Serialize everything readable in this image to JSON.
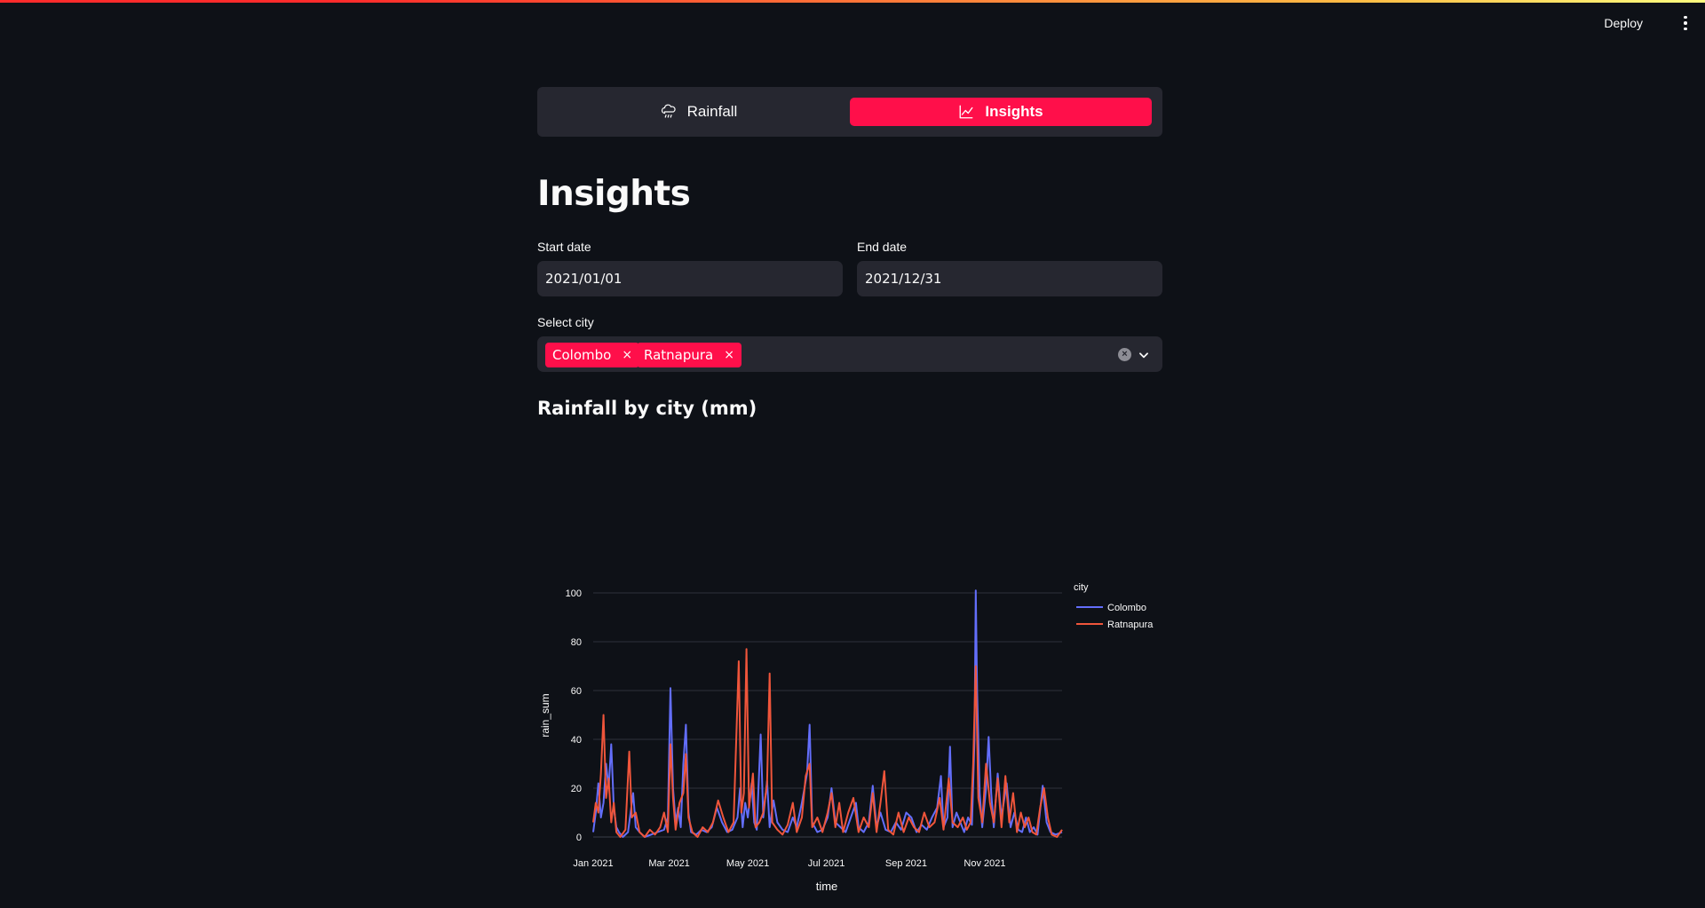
{
  "header": {
    "deploy_label": "Deploy",
    "menu_icon": "kebab-menu-icon"
  },
  "nav": {
    "items": [
      {
        "label": "Rainfall",
        "icon": "rain-cloud-icon",
        "active": false
      },
      {
        "label": "Insights",
        "icon": "line-chart-icon",
        "active": true
      }
    ],
    "accent": "#ff0f4a"
  },
  "page": {
    "title": "Insights",
    "subheader": "Rainfall by city (mm)"
  },
  "filters": {
    "start_label": "Start date",
    "start_value": "2021/01/01",
    "end_label": "End date",
    "end_value": "2021/12/31",
    "city_label": "Select city",
    "cities": [
      "Colombo",
      "Ratnapura"
    ],
    "tag_remove": "×"
  },
  "chart_data": {
    "type": "line",
    "xlabel": "time",
    "ylabel": "rain_sum",
    "legend_title": "city",
    "legend_position": "top-right",
    "grid": true,
    "ylim": [
      0,
      100
    ],
    "yticks": [
      0,
      20,
      40,
      60,
      80,
      100
    ],
    "xlim": [
      "2021-01-01",
      "2021-12-31"
    ],
    "xticks": [
      {
        "date": "2021-01-01",
        "label": "Jan 2021"
      },
      {
        "date": "2021-03-01",
        "label": "Mar 2021"
      },
      {
        "date": "2021-05-01",
        "label": "May 2021"
      },
      {
        "date": "2021-07-01",
        "label": "Jul 2021"
      },
      {
        "date": "2021-09-01",
        "label": "Sep 2021"
      },
      {
        "date": "2021-11-01",
        "label": "Nov 2021"
      }
    ],
    "series": [
      {
        "name": "Colombo",
        "color": "#636efa",
        "points": [
          [
            "2021-01-01",
            2
          ],
          [
            "2021-01-03",
            10
          ],
          [
            "2021-01-05",
            22
          ],
          [
            "2021-01-07",
            8
          ],
          [
            "2021-01-09",
            14
          ],
          [
            "2021-01-11",
            30
          ],
          [
            "2021-01-13",
            20
          ],
          [
            "2021-01-15",
            38
          ],
          [
            "2021-01-17",
            12
          ],
          [
            "2021-01-19",
            4
          ],
          [
            "2021-01-21",
            2
          ],
          [
            "2021-01-24",
            0
          ],
          [
            "2021-01-28",
            2
          ],
          [
            "2021-02-01",
            18
          ],
          [
            "2021-02-03",
            4
          ],
          [
            "2021-02-06",
            2
          ],
          [
            "2021-02-10",
            0
          ],
          [
            "2021-02-15",
            1
          ],
          [
            "2021-02-20",
            2
          ],
          [
            "2021-02-25",
            3
          ],
          [
            "2021-02-28",
            8
          ],
          [
            "2021-03-02",
            61
          ],
          [
            "2021-03-04",
            20
          ],
          [
            "2021-03-06",
            6
          ],
          [
            "2021-03-08",
            12
          ],
          [
            "2021-03-10",
            4
          ],
          [
            "2021-03-12",
            30
          ],
          [
            "2021-03-14",
            46
          ],
          [
            "2021-03-16",
            10
          ],
          [
            "2021-03-18",
            2
          ],
          [
            "2021-03-22",
            1
          ],
          [
            "2021-03-26",
            3
          ],
          [
            "2021-03-30",
            2
          ],
          [
            "2021-04-03",
            4
          ],
          [
            "2021-04-07",
            12
          ],
          [
            "2021-04-11",
            6
          ],
          [
            "2021-04-15",
            2
          ],
          [
            "2021-04-19",
            3
          ],
          [
            "2021-04-23",
            8
          ],
          [
            "2021-04-25",
            20
          ],
          [
            "2021-04-27",
            4
          ],
          [
            "2021-04-29",
            14
          ],
          [
            "2021-05-01",
            8
          ],
          [
            "2021-05-04",
            22
          ],
          [
            "2021-05-06",
            6
          ],
          [
            "2021-05-08",
            3
          ],
          [
            "2021-05-11",
            42
          ],
          [
            "2021-05-13",
            8
          ],
          [
            "2021-05-16",
            23
          ],
          [
            "2021-05-18",
            4
          ],
          [
            "2021-05-21",
            15
          ],
          [
            "2021-05-24",
            6
          ],
          [
            "2021-05-28",
            3
          ],
          [
            "2021-06-01",
            2
          ],
          [
            "2021-06-05",
            8
          ],
          [
            "2021-06-08",
            4
          ],
          [
            "2021-06-12",
            14
          ],
          [
            "2021-06-16",
            26
          ],
          [
            "2021-06-18",
            46
          ],
          [
            "2021-06-20",
            6
          ],
          [
            "2021-06-24",
            2
          ],
          [
            "2021-06-28",
            3
          ],
          [
            "2021-07-02",
            8
          ],
          [
            "2021-07-05",
            20
          ],
          [
            "2021-07-08",
            6
          ],
          [
            "2021-07-12",
            4
          ],
          [
            "2021-07-16",
            2
          ],
          [
            "2021-07-20",
            8
          ],
          [
            "2021-07-24",
            14
          ],
          [
            "2021-07-26",
            4
          ],
          [
            "2021-07-30",
            2
          ],
          [
            "2021-08-03",
            6
          ],
          [
            "2021-08-06",
            21
          ],
          [
            "2021-08-09",
            4
          ],
          [
            "2021-08-12",
            10
          ],
          [
            "2021-08-16",
            3
          ],
          [
            "2021-08-20",
            2
          ],
          [
            "2021-08-24",
            6
          ],
          [
            "2021-08-28",
            3
          ],
          [
            "2021-09-01",
            10
          ],
          [
            "2021-09-05",
            8
          ],
          [
            "2021-09-09",
            2
          ],
          [
            "2021-09-13",
            5
          ],
          [
            "2021-09-17",
            3
          ],
          [
            "2021-09-21",
            8
          ],
          [
            "2021-09-25",
            12
          ],
          [
            "2021-09-28",
            25
          ],
          [
            "2021-09-30",
            4
          ],
          [
            "2021-10-03",
            8
          ],
          [
            "2021-10-05",
            37
          ],
          [
            "2021-10-07",
            4
          ],
          [
            "2021-10-10",
            10
          ],
          [
            "2021-10-13",
            6
          ],
          [
            "2021-10-16",
            2
          ],
          [
            "2021-10-19",
            8
          ],
          [
            "2021-10-22",
            5
          ],
          [
            "2021-10-24",
            40
          ],
          [
            "2021-10-25",
            101
          ],
          [
            "2021-10-26",
            60
          ],
          [
            "2021-10-28",
            18
          ],
          [
            "2021-10-30",
            4
          ],
          [
            "2021-11-02",
            20
          ],
          [
            "2021-11-04",
            41
          ],
          [
            "2021-11-06",
            18
          ],
          [
            "2021-11-08",
            4
          ],
          [
            "2021-11-11",
            26
          ],
          [
            "2021-11-14",
            8
          ],
          [
            "2021-11-18",
            22
          ],
          [
            "2021-11-21",
            4
          ],
          [
            "2021-11-24",
            10
          ],
          [
            "2021-11-27",
            3
          ],
          [
            "2021-11-30",
            2
          ],
          [
            "2021-12-03",
            8
          ],
          [
            "2021-12-06",
            2
          ],
          [
            "2021-12-09",
            4
          ],
          [
            "2021-12-12",
            1
          ],
          [
            "2021-12-16",
            21
          ],
          [
            "2021-12-19",
            6
          ],
          [
            "2021-12-22",
            2
          ],
          [
            "2021-12-26",
            1
          ],
          [
            "2021-12-31",
            2
          ]
        ]
      },
      {
        "name": "Ratnapura",
        "color": "#ef553b",
        "points": [
          [
            "2021-01-01",
            6
          ],
          [
            "2021-01-03",
            14
          ],
          [
            "2021-01-05",
            10
          ],
          [
            "2021-01-07",
            26
          ],
          [
            "2021-01-09",
            50
          ],
          [
            "2021-01-11",
            16
          ],
          [
            "2021-01-13",
            24
          ],
          [
            "2021-01-15",
            6
          ],
          [
            "2021-01-17",
            14
          ],
          [
            "2021-01-19",
            2
          ],
          [
            "2021-01-22",
            0
          ],
          [
            "2021-01-26",
            3
          ],
          [
            "2021-01-29",
            35
          ],
          [
            "2021-01-31",
            8
          ],
          [
            "2021-02-03",
            10
          ],
          [
            "2021-02-06",
            2
          ],
          [
            "2021-02-10",
            0
          ],
          [
            "2021-02-14",
            3
          ],
          [
            "2021-02-18",
            1
          ],
          [
            "2021-02-22",
            4
          ],
          [
            "2021-02-25",
            10
          ],
          [
            "2021-02-28",
            2
          ],
          [
            "2021-03-02",
            38
          ],
          [
            "2021-03-04",
            16
          ],
          [
            "2021-03-06",
            3
          ],
          [
            "2021-03-09",
            14
          ],
          [
            "2021-03-12",
            18
          ],
          [
            "2021-03-14",
            34
          ],
          [
            "2021-03-16",
            8
          ],
          [
            "2021-03-19",
            2
          ],
          [
            "2021-03-23",
            0
          ],
          [
            "2021-03-27",
            4
          ],
          [
            "2021-03-31",
            2
          ],
          [
            "2021-04-04",
            6
          ],
          [
            "2021-04-08",
            15
          ],
          [
            "2021-04-12",
            8
          ],
          [
            "2021-04-16",
            2
          ],
          [
            "2021-04-20",
            6
          ],
          [
            "2021-04-24",
            72
          ],
          [
            "2021-04-26",
            10
          ],
          [
            "2021-04-28",
            18
          ],
          [
            "2021-04-30",
            77
          ],
          [
            "2021-05-02",
            12
          ],
          [
            "2021-05-05",
            26
          ],
          [
            "2021-05-07",
            4
          ],
          [
            "2021-05-10",
            6
          ],
          [
            "2021-05-13",
            10
          ],
          [
            "2021-05-16",
            22
          ],
          [
            "2021-05-18",
            67
          ],
          [
            "2021-05-20",
            6
          ],
          [
            "2021-05-24",
            3
          ],
          [
            "2021-05-28",
            1
          ],
          [
            "2021-06-01",
            5
          ],
          [
            "2021-06-05",
            14
          ],
          [
            "2021-06-08",
            2
          ],
          [
            "2021-06-12",
            8
          ],
          [
            "2021-06-15",
            25
          ],
          [
            "2021-06-18",
            30
          ],
          [
            "2021-06-20",
            4
          ],
          [
            "2021-06-24",
            8
          ],
          [
            "2021-06-28",
            2
          ],
          [
            "2021-07-02",
            10
          ],
          [
            "2021-07-05",
            18
          ],
          [
            "2021-07-08",
            4
          ],
          [
            "2021-07-11",
            14
          ],
          [
            "2021-07-14",
            2
          ],
          [
            "2021-07-18",
            10
          ],
          [
            "2021-07-22",
            16
          ],
          [
            "2021-07-26",
            2
          ],
          [
            "2021-07-30",
            8
          ],
          [
            "2021-08-03",
            4
          ],
          [
            "2021-08-06",
            18
          ],
          [
            "2021-08-09",
            2
          ],
          [
            "2021-08-12",
            14
          ],
          [
            "2021-08-15",
            27
          ],
          [
            "2021-08-18",
            3
          ],
          [
            "2021-08-22",
            1
          ],
          [
            "2021-08-26",
            10
          ],
          [
            "2021-08-30",
            2
          ],
          [
            "2021-09-03",
            8
          ],
          [
            "2021-09-07",
            4
          ],
          [
            "2021-09-11",
            2
          ],
          [
            "2021-09-15",
            10
          ],
          [
            "2021-09-19",
            4
          ],
          [
            "2021-09-23",
            6
          ],
          [
            "2021-09-27",
            16
          ],
          [
            "2021-09-30",
            3
          ],
          [
            "2021-10-04",
            24
          ],
          [
            "2021-10-07",
            6
          ],
          [
            "2021-10-11",
            4
          ],
          [
            "2021-10-15",
            8
          ],
          [
            "2021-10-18",
            3
          ],
          [
            "2021-10-21",
            6
          ],
          [
            "2021-10-23",
            30
          ],
          [
            "2021-10-25",
            70
          ],
          [
            "2021-10-27",
            16
          ],
          [
            "2021-10-30",
            6
          ],
          [
            "2021-11-02",
            30
          ],
          [
            "2021-11-05",
            14
          ],
          [
            "2021-11-08",
            6
          ],
          [
            "2021-11-11",
            24
          ],
          [
            "2021-11-14",
            4
          ],
          [
            "2021-11-17",
            25
          ],
          [
            "2021-11-20",
            6
          ],
          [
            "2021-11-23",
            18
          ],
          [
            "2021-11-26",
            2
          ],
          [
            "2021-11-29",
            10
          ],
          [
            "2021-12-02",
            4
          ],
          [
            "2021-12-05",
            8
          ],
          [
            "2021-12-08",
            2
          ],
          [
            "2021-12-11",
            1
          ],
          [
            "2021-12-14",
            12
          ],
          [
            "2021-12-17",
            20
          ],
          [
            "2021-12-20",
            8
          ],
          [
            "2021-12-23",
            1
          ],
          [
            "2021-12-27",
            0
          ],
          [
            "2021-12-31",
            3
          ]
        ]
      }
    ]
  }
}
